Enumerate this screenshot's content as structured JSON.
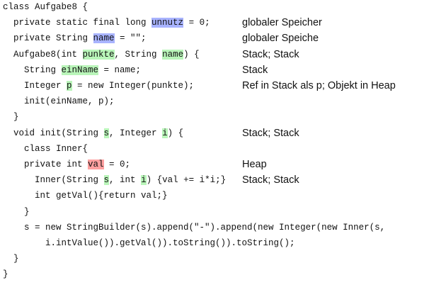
{
  "code_lines": [
    {
      "indent": 0,
      "segments": [
        {
          "text": "class Aufgabe8 {",
          "hl": ""
        }
      ]
    },
    {
      "indent": 1,
      "segments": [
        {
          "text": "private static final long ",
          "hl": ""
        },
        {
          "text": "unnutz",
          "hl": "blue"
        },
        {
          "text": " = 0;",
          "hl": ""
        }
      ]
    },
    {
      "indent": 1,
      "segments": [
        {
          "text": "private String ",
          "hl": ""
        },
        {
          "text": "name",
          "hl": "blue"
        },
        {
          "text": " = \"\";",
          "hl": ""
        }
      ]
    },
    {
      "indent": 1,
      "segments": [
        {
          "text": "Aufgabe8(int ",
          "hl": ""
        },
        {
          "text": "punkte",
          "hl": "green"
        },
        {
          "text": ", String ",
          "hl": ""
        },
        {
          "text": "name",
          "hl": "green"
        },
        {
          "text": ") {",
          "hl": ""
        }
      ]
    },
    {
      "indent": 2,
      "segments": [
        {
          "text": "String ",
          "hl": ""
        },
        {
          "text": "einName",
          "hl": "green"
        },
        {
          "text": " = name;",
          "hl": ""
        }
      ]
    },
    {
      "indent": 2,
      "segments": [
        {
          "text": "Integer ",
          "hl": ""
        },
        {
          "text": "p",
          "hl": "green"
        },
        {
          "text": " = new Integer(punkte);",
          "hl": ""
        }
      ]
    },
    {
      "indent": 2,
      "segments": [
        {
          "text": "init(einName, p);",
          "hl": ""
        }
      ]
    },
    {
      "indent": 1,
      "segments": [
        {
          "text": "}",
          "hl": ""
        }
      ]
    },
    {
      "indent": 1,
      "segments": [
        {
          "text": "void init(String ",
          "hl": ""
        },
        {
          "text": "s",
          "hl": "green"
        },
        {
          "text": ", Integer ",
          "hl": ""
        },
        {
          "text": "i",
          "hl": "green"
        },
        {
          "text": ") {",
          "hl": ""
        }
      ]
    },
    {
      "indent": 2,
      "segments": [
        {
          "text": "class Inner{",
          "hl": ""
        }
      ]
    },
    {
      "indent": 2,
      "segments": [
        {
          "text": "private int ",
          "hl": ""
        },
        {
          "text": "val",
          "hl": "red"
        },
        {
          "text": " = 0;",
          "hl": ""
        }
      ]
    },
    {
      "indent": 3,
      "segments": [
        {
          "text": "Inner(String ",
          "hl": ""
        },
        {
          "text": "s",
          "hl": "green"
        },
        {
          "text": ", int ",
          "hl": ""
        },
        {
          "text": "i",
          "hl": "green"
        },
        {
          "text": ") {val += i*i;}",
          "hl": ""
        }
      ]
    },
    {
      "indent": 3,
      "segments": [
        {
          "text": "int getVal(){return val;}",
          "hl": ""
        }
      ]
    },
    {
      "indent": 2,
      "segments": [
        {
          "text": "}",
          "hl": ""
        }
      ]
    },
    {
      "indent": 2,
      "segments": [
        {
          "text": "s = new StringBuilder(s).append(\"-\").append(new Integer(new Inner(s,",
          "hl": ""
        }
      ]
    },
    {
      "indent": 4,
      "segments": [
        {
          "text": "i.intValue()).getVal()).toString()).toString();",
          "hl": ""
        }
      ]
    },
    {
      "indent": 1,
      "segments": [
        {
          "text": "}",
          "hl": ""
        }
      ]
    },
    {
      "indent": 0,
      "segments": [
        {
          "text": "}",
          "hl": ""
        }
      ]
    }
  ],
  "annotations": [
    {
      "line": 1,
      "text": "globaler Speicher"
    },
    {
      "line": 2,
      "text": "globaler Speiche"
    },
    {
      "line": 3,
      "text": "Stack; Stack"
    },
    {
      "line": 4,
      "text": "Stack"
    },
    {
      "line": 5,
      "text": "Ref in Stack als p; Objekt in Heap"
    },
    {
      "line": 8,
      "text": "Stack; Stack"
    },
    {
      "line": 10,
      "text": "Heap"
    },
    {
      "line": 11,
      "text": "Stack; Stack"
    }
  ]
}
